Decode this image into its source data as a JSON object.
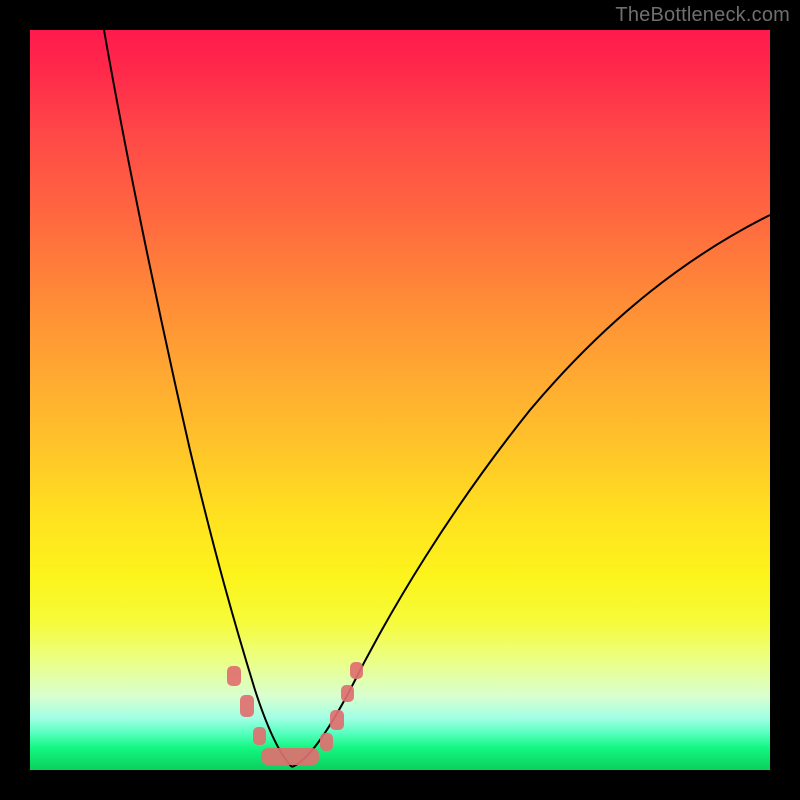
{
  "watermark": "TheBottleneck.com",
  "colors": {
    "frame": "#000000",
    "curve": "#000000",
    "marker": "#e07070",
    "gradient_top": "#ff1a4c",
    "gradient_bottom": "#0bcf5e"
  },
  "chart_data": {
    "type": "line",
    "title": "",
    "xlabel": "",
    "ylabel": "",
    "xlim": [
      0,
      100
    ],
    "ylim": [
      0,
      100
    ],
    "grid": false,
    "legend": false,
    "series": [
      {
        "name": "left-curve",
        "x": [
          10,
          12,
          15,
          18,
          21,
          24,
          26,
          28,
          30,
          32,
          33,
          34,
          35
        ],
        "y": [
          100,
          88,
          72,
          56,
          41,
          27,
          19,
          12,
          7,
          3,
          1.5,
          0.7,
          0.3
        ]
      },
      {
        "name": "right-curve",
        "x": [
          35,
          37,
          40,
          44,
          50,
          58,
          68,
          80,
          92,
          100
        ],
        "y": [
          0.3,
          1.2,
          4,
          10,
          20,
          33,
          47,
          59,
          69,
          75
        ]
      },
      {
        "name": "markers",
        "x": [
          27.5,
          29.5,
          31,
          33,
          35,
          37,
          39,
          41,
          41.8,
          43
        ],
        "y": [
          12,
          8,
          3,
          1,
          0.7,
          0.7,
          1.3,
          4,
          7,
          11
        ]
      }
    ]
  }
}
